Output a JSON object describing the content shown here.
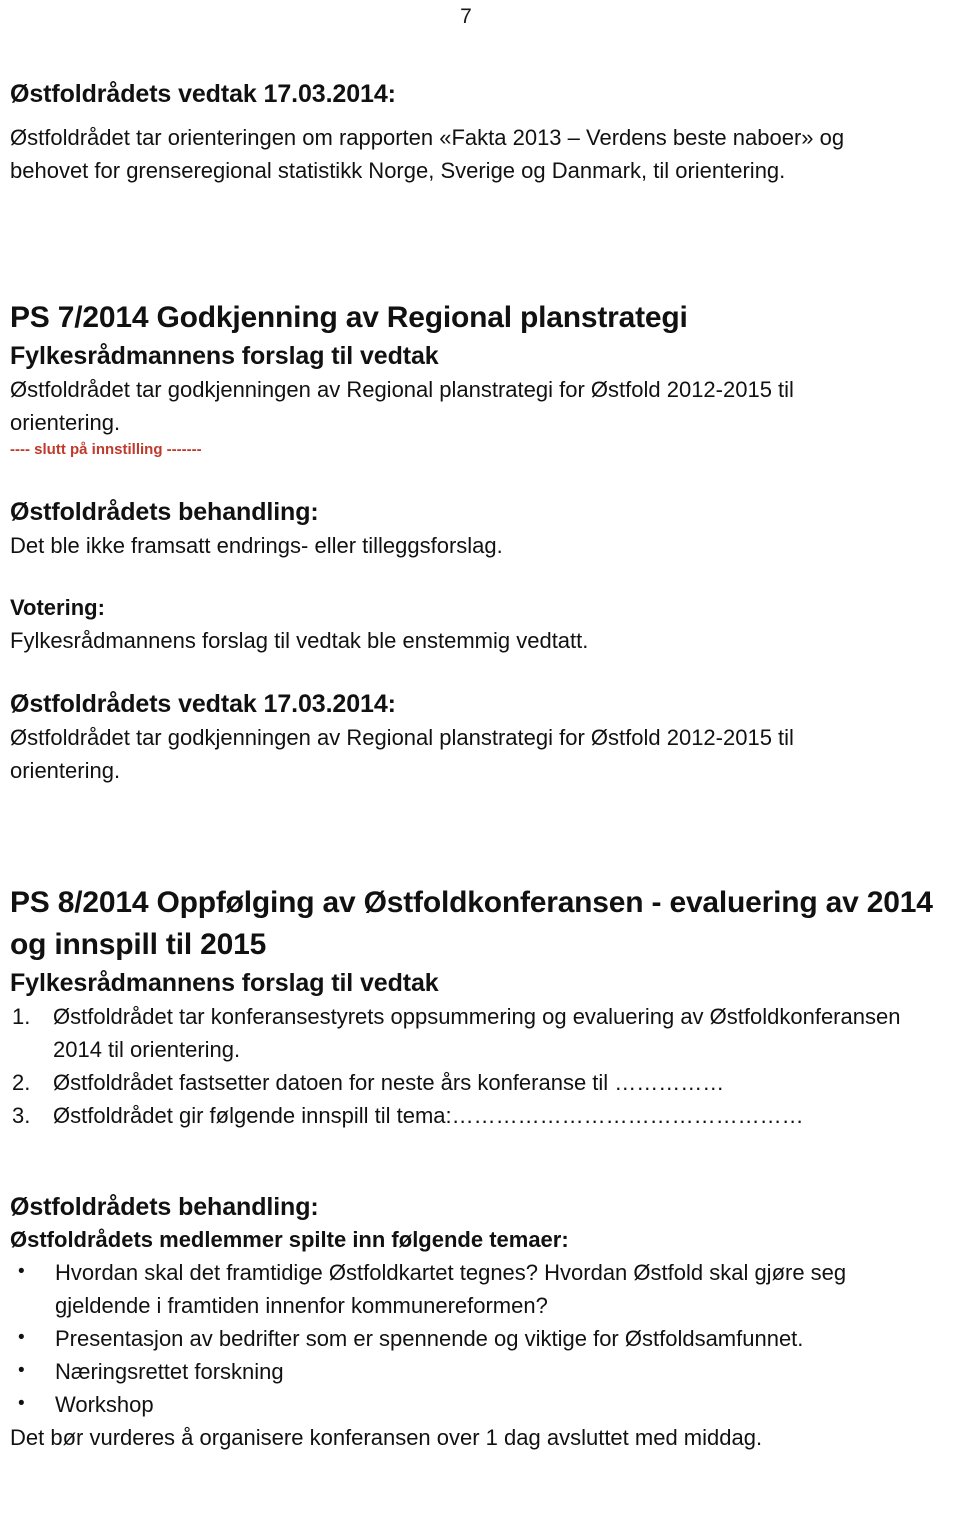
{
  "page": {
    "number": "7"
  },
  "section_vedtak_ps6": {
    "heading": "Østfoldrådets vedtak 17.03.2014:",
    "body": "Østfoldrådet tar orienteringen om rapporten «Fakta 2013 – Verdens beste naboer» og behovet for grenseregional statistikk Norge, Sverige og Danmark, til orientering."
  },
  "section_ps7": {
    "title": "PS 7/2014 Godkjenning av Regional planstrategi",
    "proposal_heading": "Fylkesrådmannens forslag til vedtak",
    "proposal_body": "Østfoldrådet tar godkjenningen av Regional planstrategi for Østfold 2012-2015 til orientering.",
    "end_note": "---- slutt på innstilling -------",
    "behandling_heading": "Østfoldrådets behandling:",
    "behandling_body": "Det ble ikke framsatt endrings- eller tilleggsforslag.",
    "votering_heading": "Votering:",
    "votering_body": "Fylkesrådmannens forslag til vedtak ble enstemmig vedtatt.",
    "vedtak_heading": "Østfoldrådets vedtak 17.03.2014:",
    "vedtak_body": "Østfoldrådet tar godkjenningen av Regional planstrategi for Østfold 2012-2015 til orientering."
  },
  "section_ps8": {
    "title": "PS 8/2014 Oppfølging av Østfoldkonferansen - evaluering av 2014 og innspill til 2015",
    "proposal_heading": "Fylkesrådmannens forslag til vedtak",
    "proposal_items": [
      {
        "num": "1.",
        "text": "Østfoldrådet tar konferansestyrets oppsummering og evaluering av Østfoldkonferansen 2014 til orientering."
      },
      {
        "num": "2.",
        "text": "Østfoldrådet fastsetter datoen for neste års konferanse til ……………"
      },
      {
        "num": "3.",
        "text": "Østfoldrådet gir følgende innspill til tema:…………………………………………"
      }
    ],
    "behandling_heading": "Østfoldrådets behandling:",
    "members_heading": "Østfoldrådets medlemmer spilte inn følgende temaer:",
    "bullets": [
      {
        "bullet": "•",
        "text": "Hvordan skal det framtidige Østfoldkartet tegnes? Hvordan Østfold skal gjøre seg gjeldende i framtiden innenfor kommunereformen?"
      },
      {
        "bullet": "•",
        "text": "Presentasjon av bedrifter som er spennende og viktige for Østfoldsamfunnet."
      },
      {
        "bullet": "•",
        "text": "Næringsrettet forskning"
      },
      {
        "bullet": "•",
        "text": "Workshop"
      }
    ],
    "closing_text": "Det bør vurderes å organisere konferansen over 1 dag avsluttet med middag."
  },
  "colors": {
    "text": "#111111",
    "accent_red": "#c0392b"
  }
}
